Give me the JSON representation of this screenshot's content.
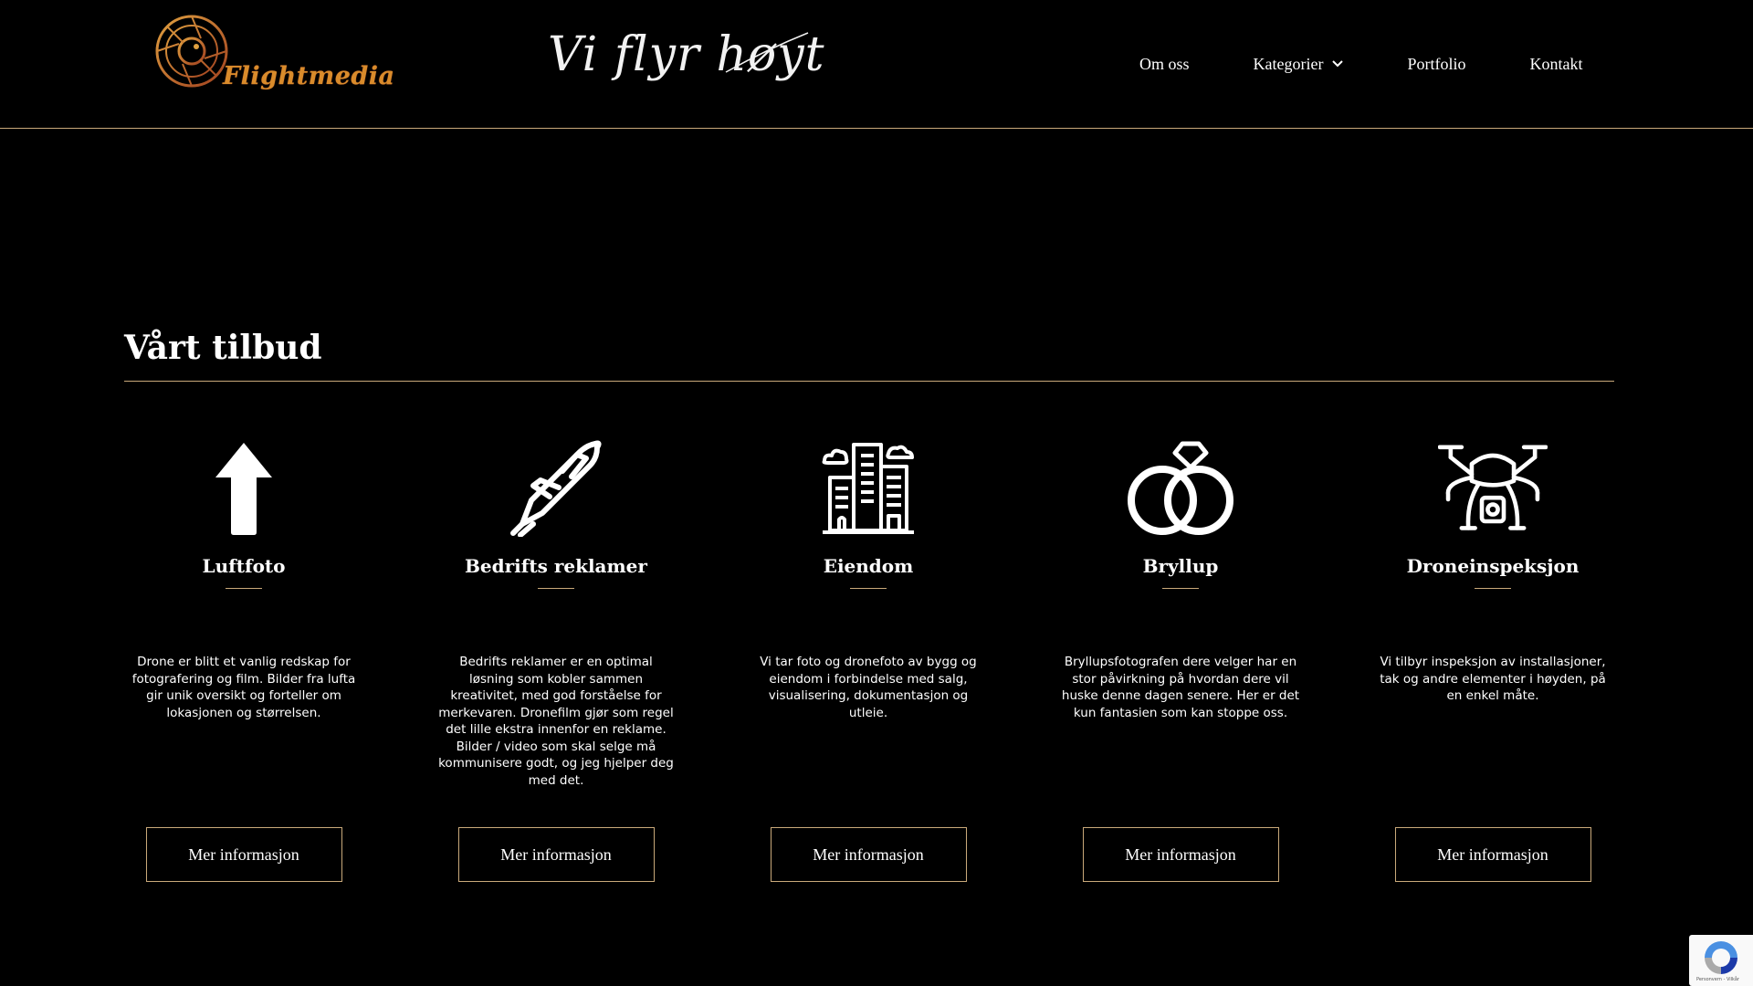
{
  "header": {
    "logo_text": "Flightmedia",
    "tagline": "Vi flyr høyt",
    "nav": [
      {
        "label": "Om oss"
      },
      {
        "label": "Kategorier",
        "has_dropdown": true
      },
      {
        "label": "Portfolio"
      },
      {
        "label": "Kontakt"
      }
    ]
  },
  "main": {
    "section_title": "Vårt tilbud",
    "cards": [
      {
        "icon": "arrow-up-icon",
        "title": "Luftfoto",
        "description": "Drone er blitt et vanlig redskap for fotografering og film. Bilder fra lufta gir unik oversikt og forteller om lokasjonen og størrelsen.",
        "button": "Mer informasjon"
      },
      {
        "icon": "airplane-icon",
        "title": "Bedrifts reklamer",
        "description": "Bedrifts reklamer er en optimal løsning som kobler sammen kreativitet, med god forståelse for merkevaren. Dronefilm gjør som regel det lille ekstra innenfor en reklame. Bilder / video som skal selge må kommunisere godt, og jeg hjelper deg med det.",
        "button": "Mer informasjon"
      },
      {
        "icon": "buildings-icon",
        "title": "Eiendom",
        "description": "Vi tar foto og dronefoto av bygg og eiendom i forbindelse med salg, visualisering, dokumentasjon og utleie.",
        "button": "Mer informasjon"
      },
      {
        "icon": "wedding-rings-icon",
        "title": "Bryllup",
        "description": "Bryllupsfotografen dere velger har en stor påvirkning på hvordan dere vil huske denne dagen senere. Her er det kun fantasien som kan stoppe oss.",
        "button": "Mer informasjon"
      },
      {
        "icon": "drone-icon",
        "title": "Droneinspeksjon",
        "description": "Vi tilbyr inspeksjon av installasjoner, tak og andre elementer i høyden, på en enkel måte.",
        "button": "Mer informasjon"
      }
    ]
  },
  "recaptcha": {
    "text": "Personvern - Vilkår",
    "icon": "recaptcha-icon"
  },
  "colors": {
    "background": "#000000",
    "accent": "#c9a97a",
    "logo": "#d98b2b"
  }
}
